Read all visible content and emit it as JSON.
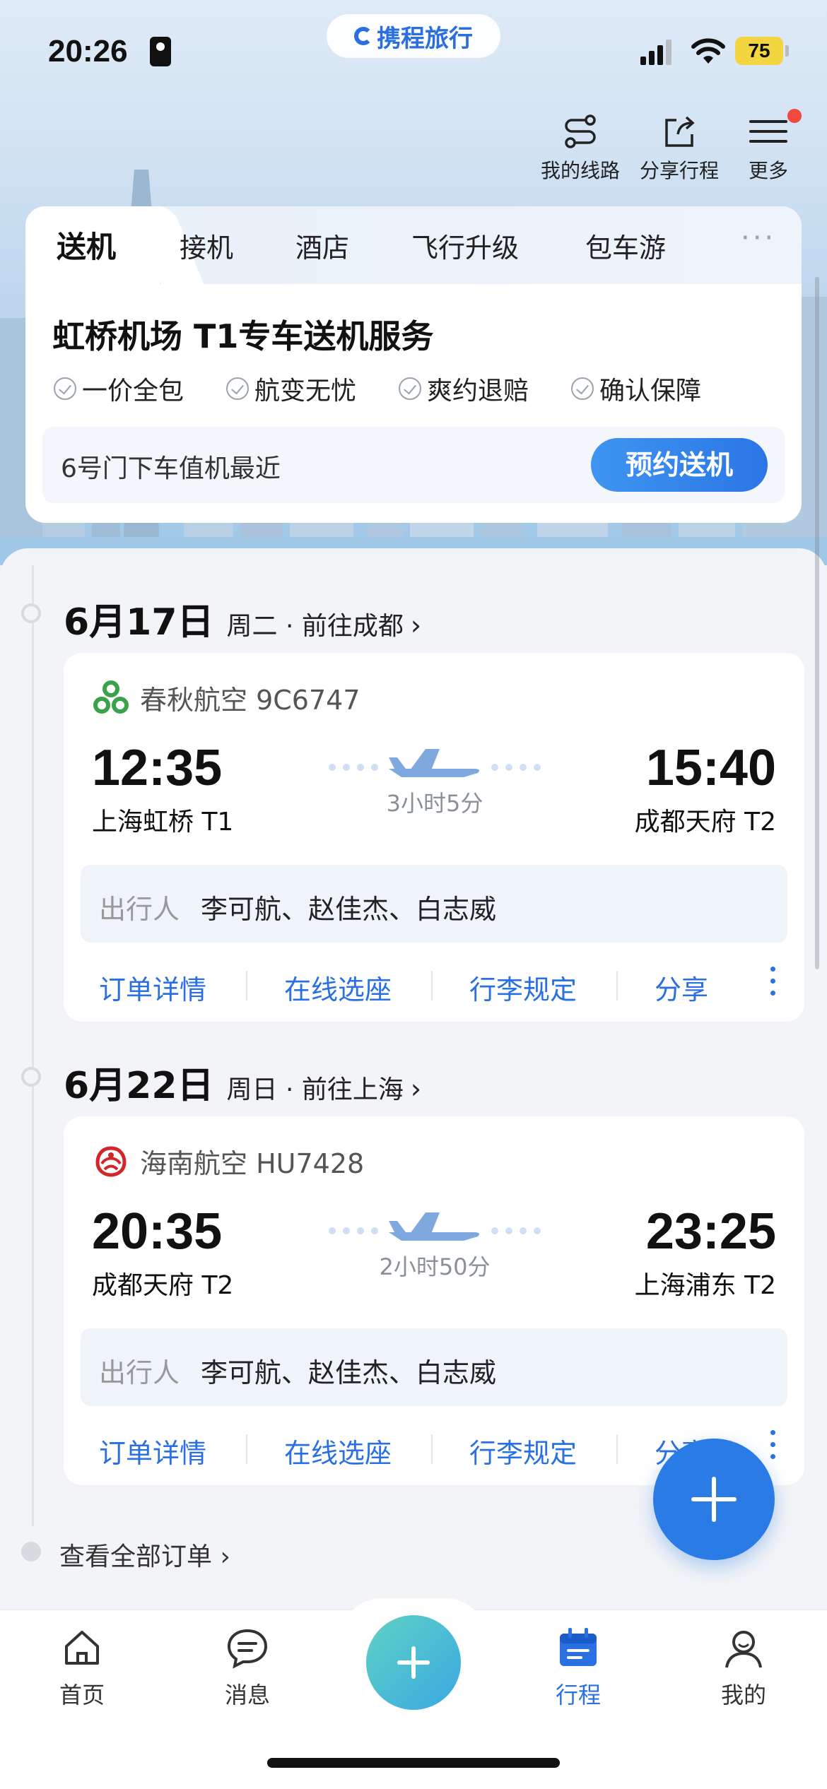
{
  "status_bar": {
    "time": "20:26",
    "brand": "携程旅行",
    "battery": "75"
  },
  "top_actions": {
    "my_routes": "我的线路",
    "share_trip": "分享行程",
    "more": "更多"
  },
  "service": {
    "tabs": [
      "送机",
      "接机",
      "酒店",
      "飞行升级",
      "包车游"
    ],
    "more": "···",
    "title": "虹桥机场 T1专车送机服务",
    "features": [
      "一价全包",
      "航变无忧",
      "爽约退赔",
      "确认保障"
    ],
    "hint": "6号门下车值机最近",
    "book_label": "预约送机"
  },
  "trips": [
    {
      "date": "6月17日",
      "sub": "周二 · 前往成都",
      "airline": "春秋航空 9C6747",
      "dep_time": "12:35",
      "dep_airport": "上海虹桥 T1",
      "arr_time": "15:40",
      "arr_airport": "成都天府 T2",
      "duration": "3小时5分",
      "passenger_label": "出行人",
      "passengers": "李可航、赵佳杰、白志威",
      "actions": [
        "订单详情",
        "在线选座",
        "行李规定",
        "分享"
      ]
    },
    {
      "date": "6月22日",
      "sub": "周日 · 前往上海",
      "airline": "海南航空 HU7428",
      "dep_time": "20:35",
      "dep_airport": "成都天府 T2",
      "arr_time": "23:25",
      "arr_airport": "上海浦东 T2",
      "duration": "2小时50分",
      "passenger_label": "出行人",
      "passengers": "李可航、赵佳杰、白志威",
      "actions": [
        "订单详情",
        "在线选座",
        "行李规定",
        "分享"
      ]
    }
  ],
  "view_all": "查看全部订单 ›",
  "bottom_nav": {
    "home": "首页",
    "messages": "消息",
    "trips": "行程",
    "me": "我的"
  },
  "colors": {
    "accent": "#2a70e0",
    "spring_airlines": "#3aa34a",
    "hainan_airlines": "#d3262b"
  }
}
